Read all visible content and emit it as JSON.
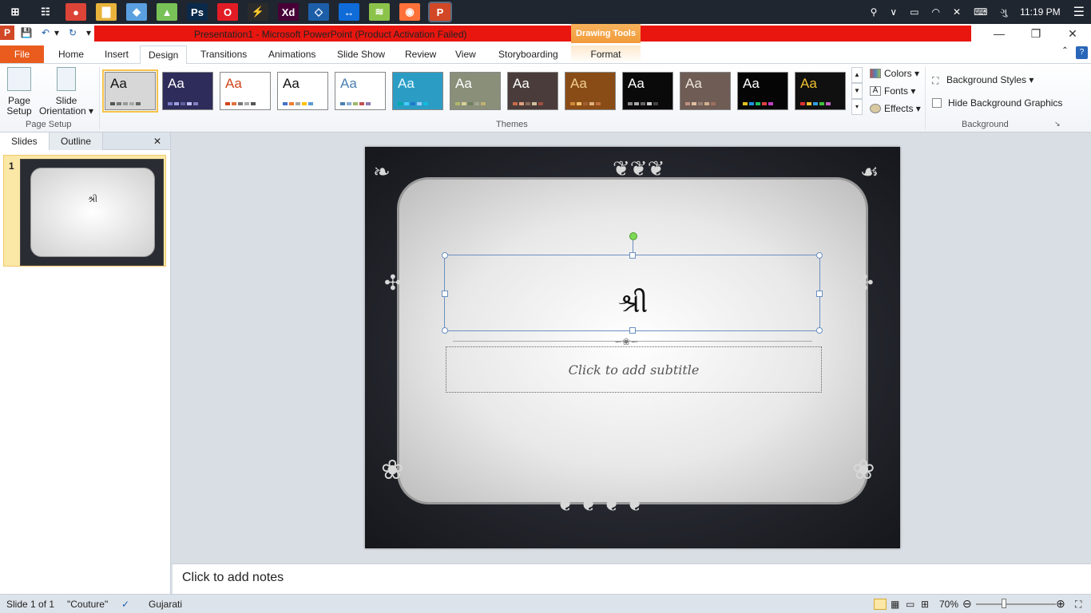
{
  "taskbar": {
    "apps": [
      {
        "icon": "windows-start-icon",
        "label": "⊞",
        "color": "#1f2630"
      },
      {
        "icon": "task-view-icon",
        "label": "☷",
        "color": "#1f2630"
      },
      {
        "icon": "chrome-icon",
        "label": "●",
        "color": "#db4437"
      },
      {
        "icon": "file-explorer-icon",
        "label": "▇",
        "color": "#e8b33b"
      },
      {
        "icon": "3d-box-icon",
        "label": "◆",
        "color": "#5aa0e0"
      },
      {
        "icon": "android-studio-icon",
        "label": "▲",
        "color": "#78c257"
      },
      {
        "icon": "photoshop-icon",
        "label": "Ps",
        "color": "#0b2a4a"
      },
      {
        "icon": "opera-icon",
        "label": "O",
        "color": "#e21c24"
      },
      {
        "icon": "zoomit-icon",
        "label": "⚡",
        "color": "#2b2b2b"
      },
      {
        "icon": "adobe-xd-icon",
        "label": "Xd",
        "color": "#470137"
      },
      {
        "icon": "virtualbox-icon",
        "label": "◇",
        "color": "#1d5ea8"
      },
      {
        "icon": "teamviewer-icon",
        "label": "↔",
        "color": "#0e6bd8"
      },
      {
        "icon": "layers-app-icon",
        "label": "≋",
        "color": "#8bc34a"
      },
      {
        "icon": "firefox-icon",
        "label": "◉",
        "color": "#ff7139"
      },
      {
        "icon": "powerpoint-icon",
        "label": "P",
        "color": "#d24726"
      }
    ],
    "tray": {
      "people": "⚲",
      "chevron": "∨",
      "battery": "▭",
      "wifi": "◠",
      "volume": "✕",
      "keyboard": "⌨",
      "lang": "ગુ",
      "time": "11:19 PM",
      "notification": "☰"
    }
  },
  "window": {
    "title": "Presentation1  -  Microsoft PowerPoint (Product Activation Failed)",
    "contextual_tab": "Drawing Tools",
    "controls": {
      "minimize": "—",
      "restore": "❐",
      "close": "✕"
    }
  },
  "qat": {
    "app_icon": "P",
    "save": "💾",
    "undo": "↶",
    "undo_dd": "▾",
    "redo": "↻",
    "customize": "▾"
  },
  "tabs": [
    {
      "label": "File",
      "key": "file"
    },
    {
      "label": "Home",
      "key": "home"
    },
    {
      "label": "Insert",
      "key": "insert"
    },
    {
      "label": "Design",
      "key": "design"
    },
    {
      "label": "Transitions",
      "key": "transitions"
    },
    {
      "label": "Animations",
      "key": "animations"
    },
    {
      "label": "Slide Show",
      "key": "slideshow"
    },
    {
      "label": "Review",
      "key": "review"
    },
    {
      "label": "View",
      "key": "view"
    },
    {
      "label": "Storyboarding",
      "key": "storyboarding"
    },
    {
      "label": "Format",
      "key": "format"
    }
  ],
  "ribbon": {
    "page_setup": {
      "label": "Page Setup",
      "page_setup_btn_1": "Page",
      "page_setup_btn_2": "Setup",
      "orientation_1": "Slide",
      "orientation_2": "Orientation ▾"
    },
    "themes_label": "Themes",
    "themes": [
      {
        "text": "Aa",
        "bg": "#d7d7d7",
        "fg": "#111",
        "selected": true,
        "bars": [
          "#555",
          "#777",
          "#999",
          "#aaa",
          "#666"
        ]
      },
      {
        "text": "Aa",
        "bg": "#2e2c5a",
        "fg": "#fff",
        "selected": false,
        "bars": [
          "#7a7ac8",
          "#a0a0e0",
          "#6060a0",
          "#c0c0ff",
          "#8080c0"
        ]
      },
      {
        "text": "Aa",
        "bg": "#ffffff",
        "fg": "#d0451b",
        "selected": false,
        "bars": [
          "#d0451b",
          "#e07040",
          "#777",
          "#aaa",
          "#555"
        ]
      },
      {
        "text": "Aa",
        "bg": "#ffffff",
        "fg": "#111",
        "selected": false,
        "bars": [
          "#4472c4",
          "#ed7d31",
          "#a5a5a5",
          "#ffc000",
          "#5b9bd5"
        ]
      },
      {
        "text": "Aa",
        "bg": "#ffffff",
        "fg": "#4a7fb0",
        "selected": false,
        "bars": [
          "#4a7fb0",
          "#8aaed4",
          "#9fb86b",
          "#c05050",
          "#8c7bb0"
        ]
      },
      {
        "text": "Aa",
        "bg": "#2b9dc5",
        "fg": "#e9fbff",
        "selected": false,
        "bars": [
          "#0aa",
          "#4cf",
          "#27c",
          "#9cf",
          "#1bd"
        ]
      },
      {
        "text": "Aa",
        "bg": "#8a8f7a",
        "fg": "#fff",
        "selected": false,
        "bars": [
          "#b0b86a",
          "#d8d09a",
          "#708060",
          "#a0a890",
          "#c0b070"
        ]
      },
      {
        "text": "Aa",
        "bg": "#4a3c3a",
        "fg": "#fff",
        "selected": false,
        "bars": [
          "#c86a4a",
          "#e0a080",
          "#8a6a5a",
          "#d0c0a0",
          "#a05040"
        ]
      },
      {
        "text": "Aa",
        "bg": "#8a4c17",
        "fg": "#f0d090",
        "selected": false,
        "bars": [
          "#d08a3a",
          "#f0c070",
          "#a06030",
          "#e0b080",
          "#c07040"
        ]
      },
      {
        "text": "Aa",
        "bg": "#0a0a0a",
        "fg": "#fff",
        "selected": false,
        "bars": [
          "#888",
          "#aaa",
          "#666",
          "#ccc",
          "#444"
        ]
      },
      {
        "text": "Aa",
        "bg": "#6e5c55",
        "fg": "#f0e6dc",
        "selected": false,
        "bars": [
          "#c09080",
          "#e0c0a0",
          "#9a8070",
          "#d0b090",
          "#a07060"
        ]
      },
      {
        "text": "Aa",
        "bg": "#050505",
        "fg": "#fff",
        "selected": false,
        "bars": [
          "#e0c020",
          "#2090e0",
          "#20c060",
          "#e04040",
          "#c040c0"
        ]
      },
      {
        "text": "Aa",
        "bg": "#101010",
        "fg": "#f0c030",
        "selected": false,
        "bars": [
          "#e03030",
          "#f0c030",
          "#30a0e0",
          "#40c040",
          "#c060c0"
        ]
      }
    ],
    "theme_scroll": {
      "up": "▲",
      "down": "▼",
      "more": "▾"
    },
    "theme_options": {
      "colors": "Colors ▾",
      "fonts": "Fonts ▾",
      "effects": "Effects ▾"
    },
    "background": {
      "label": "Background",
      "styles": "Background Styles ▾",
      "hide": "Hide Background Graphics",
      "launcher": "↘"
    }
  },
  "panel": {
    "tabs": [
      "Slides",
      "Outline"
    ],
    "close": "✕",
    "slide_number": "1",
    "thumb_title": "શ્રી"
  },
  "slide": {
    "title": "શ્રી",
    "subtitle": "Click to add subtitle"
  },
  "notes": {
    "placeholder": "Click to add notes"
  },
  "status": {
    "slide": "Slide 1 of 1",
    "theme": "\"Couture\"",
    "language": "Gujarati",
    "zoom": "70%",
    "zoom_minus": "⊖",
    "zoom_plus": "⊕"
  }
}
